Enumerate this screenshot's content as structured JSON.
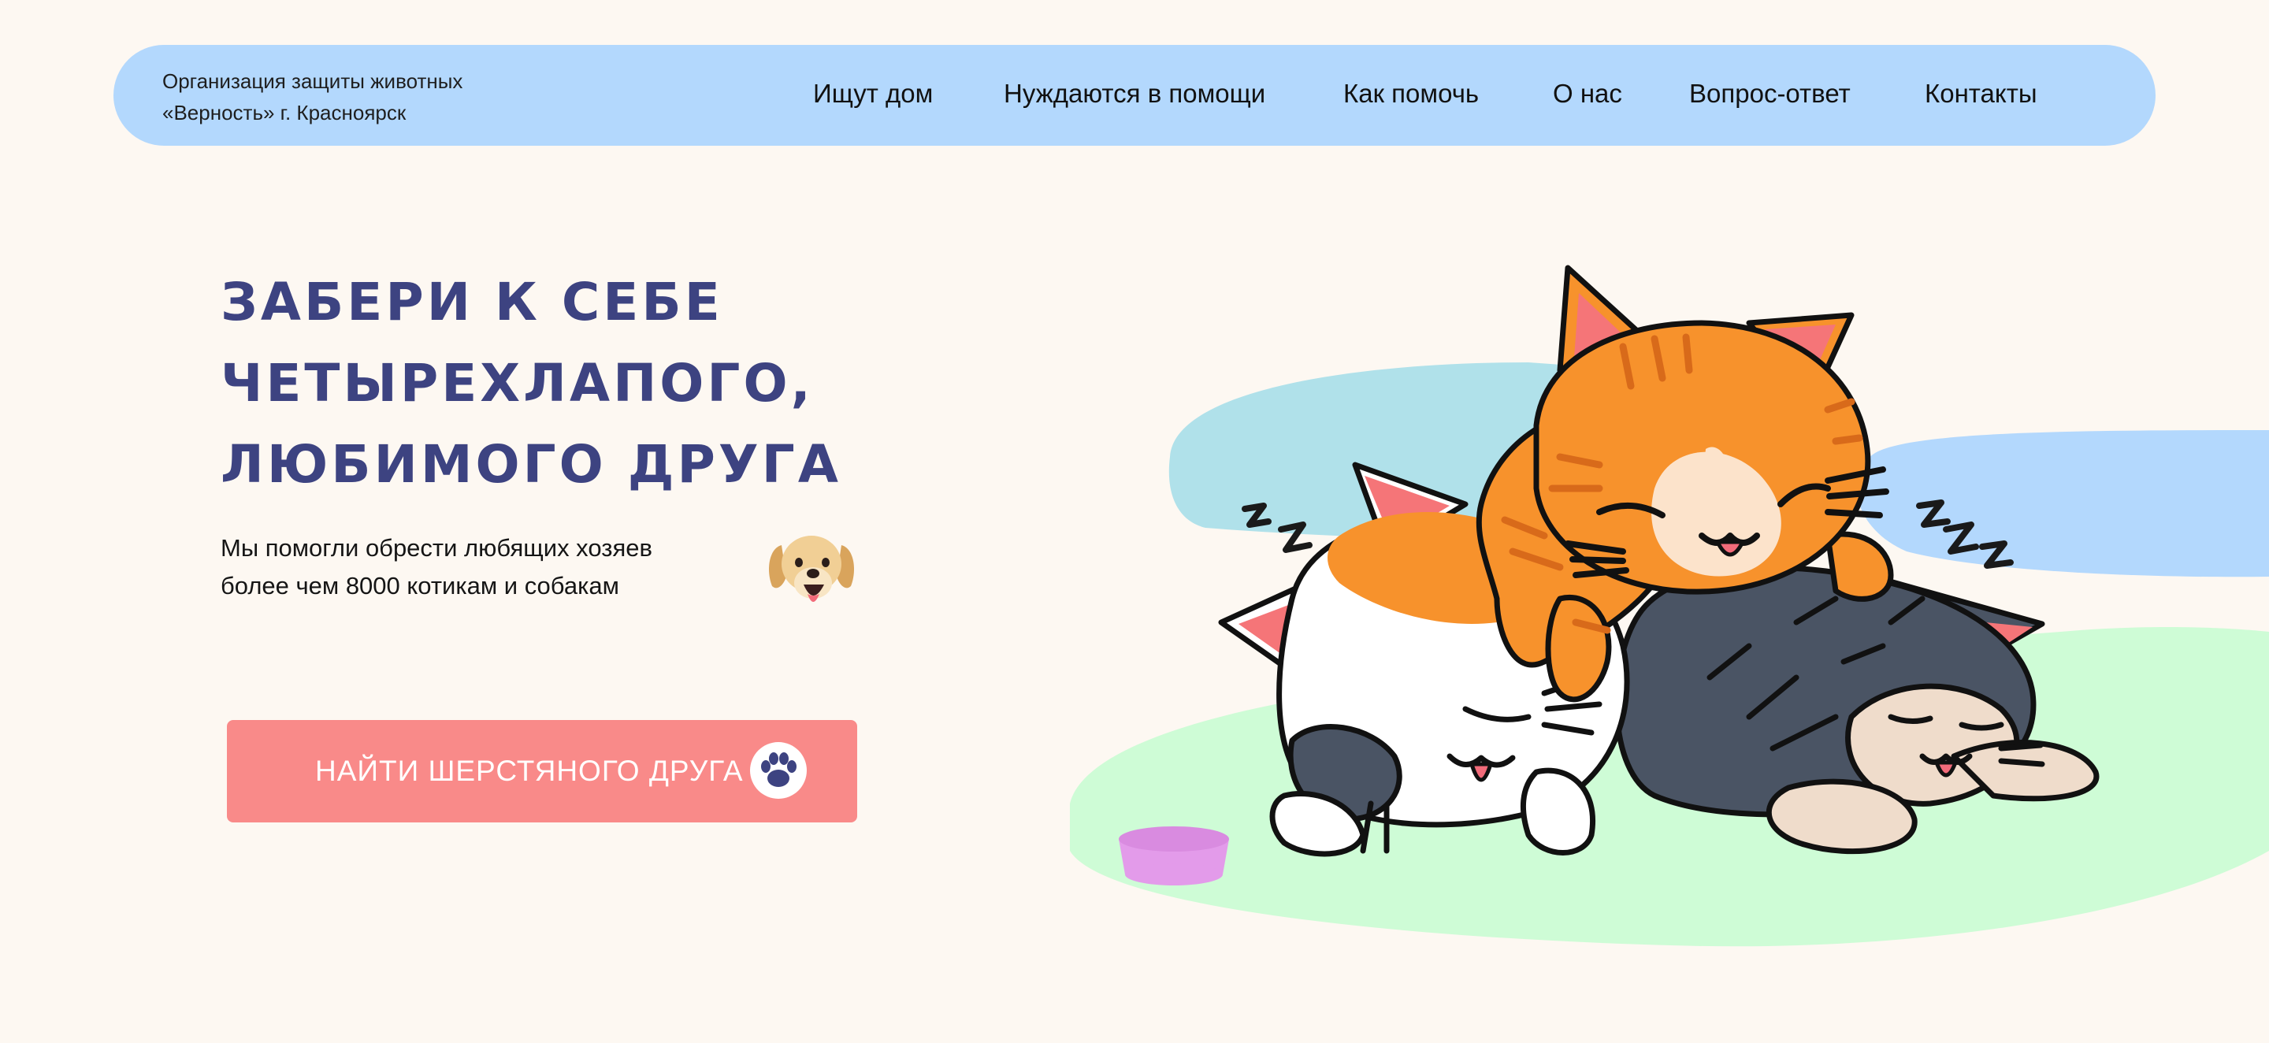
{
  "header": {
    "org_line1": "Организация защиты животных",
    "org_line2": "«Верность» г. Красноярск",
    "nav": [
      {
        "label": "Ищут дом"
      },
      {
        "label": "Нуждаются в помощи"
      },
      {
        "label": "Как помочь"
      },
      {
        "label": "О нас"
      },
      {
        "label": "Вопрос-ответ"
      },
      {
        "label": "Контакты"
      }
    ]
  },
  "hero": {
    "title_lines": [
      "Забери к себе",
      "четырехлапого,",
      "любимого друга"
    ],
    "subtitle_lines": [
      "Мы помогли обрести любящих хозяев",
      "более чем 8000 котикам и собакам"
    ],
    "cta_label": "НАЙТИ ШЕРСТЯНОГО ДРУГА"
  },
  "icons": {
    "dog": "dog-face-icon",
    "paw": "paw-icon"
  },
  "illustration": {
    "subject": "sleeping-cats-illustration",
    "bowl": "pet-bowl"
  },
  "colors": {
    "background": "#FDF8F2",
    "header_bg": "#B3D8FD",
    "title": "#3D4381",
    "button": "#F98A89",
    "orange_cat": "#F7922C",
    "gray_cat": "#4A5464",
    "grass": "#CEFCD6",
    "sky_blob": "#B0E1EA",
    "bowl": "#E39BEA"
  }
}
